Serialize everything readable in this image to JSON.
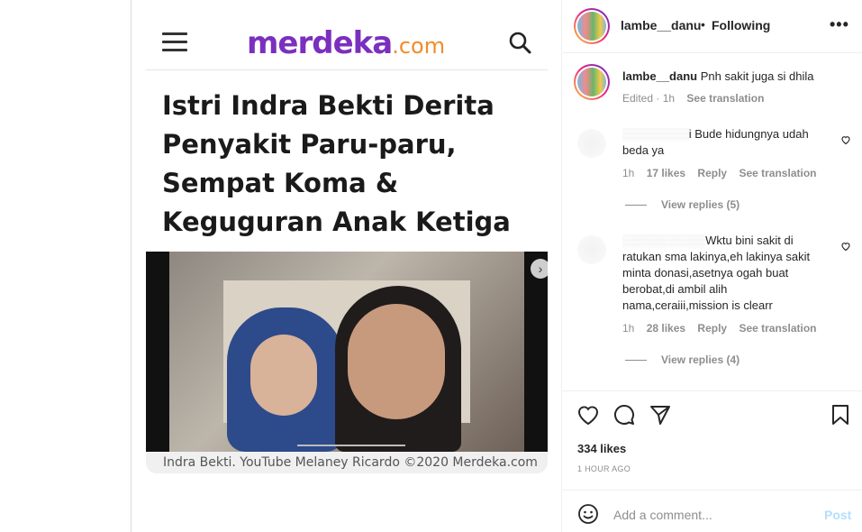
{
  "media": {
    "site_name": "merdeka",
    "site_tld": ".com",
    "headline_lines": [
      "Istri Indra Bekti Derita",
      "Penyakit Paru-paru,",
      "Sempat Koma &",
      "Keguguran Anak Ketiga"
    ],
    "next_arrow": "›",
    "photo_caption": "Indra Bekti. YouTube Melaney Ricardo ©2020 Merdeka.com"
  },
  "post": {
    "username": "lambe__danu",
    "follow_sep": "•",
    "follow_status": "Following",
    "more_label": "•••",
    "caption_user": "lambe__danu",
    "caption_text": "Pnh sakit juga si dhila",
    "caption_edited": "Edited · 1h",
    "caption_translate": "See translation",
    "comments": [
      {
        "user": "i",
        "text_lines": [
          "i Bude hidungnya udah",
          "beda ya"
        ],
        "time": "1h",
        "likes": "17 likes",
        "reply": "Reply",
        "translate": "See translation",
        "view_replies": "View replies (5)"
      },
      {
        "user": "",
        "text_lines": [
          "Wktu bini sakit di",
          "ratukan sma lakinya,eh lakinya sakit",
          "minta donasi,asetnya ogah buat",
          "berobat,di ambil alih",
          "nama,ceraiii,mission is clearr"
        ],
        "time": "1h",
        "likes": "28 likes",
        "reply": "Reply",
        "translate": "See translation",
        "view_replies": "View replies (4)"
      }
    ],
    "likes_count": "334 likes",
    "time_ago": "1 HOUR AGO",
    "add_comment_placeholder": "Add a comment...",
    "post_button": "Post"
  },
  "colors": {
    "link_blue_disabled": "#b2dffc",
    "secondary_text": "#8e8e8e",
    "merdeka_purple": "#7b2fbf",
    "merdeka_orange": "#f28c28"
  }
}
